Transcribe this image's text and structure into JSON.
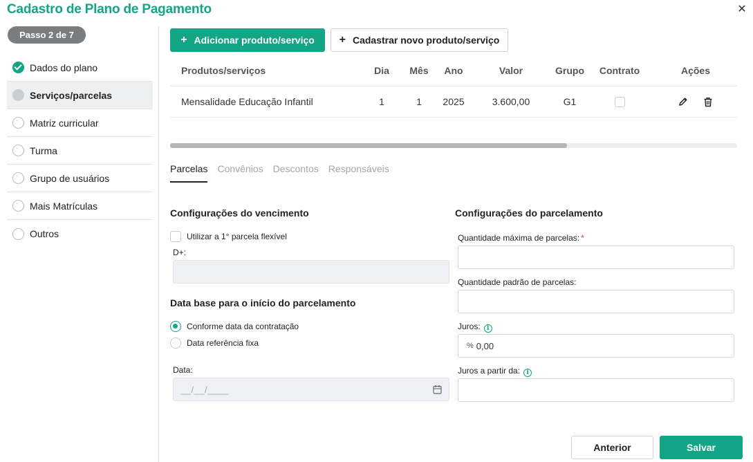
{
  "title": "Cadastro de Plano de Pagamento",
  "step_badge": "Passo 2 de 7",
  "sidebar": {
    "items": [
      {
        "label": "Dados do plano",
        "state": "done"
      },
      {
        "label": "Serviços/parcelas",
        "state": "current"
      },
      {
        "label": "Matriz curricular",
        "state": "pending"
      },
      {
        "label": "Turma",
        "state": "pending"
      },
      {
        "label": "Grupo de usuários",
        "state": "pending"
      },
      {
        "label": "Mais Matrículas",
        "state": "pending"
      },
      {
        "label": "Outros",
        "state": "pending"
      }
    ]
  },
  "toolbar": {
    "add_label": "Adicionar produto/serviço",
    "new_label": "Cadastrar novo produto/serviço"
  },
  "table": {
    "headers": {
      "produto": "Produtos/serviços",
      "dia": "Dia",
      "mes": "Mês",
      "ano": "Ano",
      "valor": "Valor",
      "grupo": "Grupo",
      "contrato": "Contrato",
      "acoes": "Ações"
    },
    "rows": [
      {
        "produto": "Mensalidade Educação Infantil",
        "dia": "1",
        "mes": "1",
        "ano": "2025",
        "valor": "3.600,00",
        "grupo": "G1",
        "contrato": false
      }
    ]
  },
  "scroll_position_fraction": 0.7,
  "tabs": [
    {
      "label": "Parcelas",
      "active": true
    },
    {
      "label": "Convênios",
      "active": false
    },
    {
      "label": "Descontos",
      "active": false
    },
    {
      "label": "Responsáveis",
      "active": false
    }
  ],
  "vencimento": {
    "title": "Configurações do vencimento",
    "flex_label": "Utilizar a 1° parcela flexível",
    "flex_checked": false,
    "dplus_label": "D+:",
    "dplus_value": ""
  },
  "data_base": {
    "title": "Data base para o início do parcelamento",
    "options": [
      {
        "label": "Conforme data da contratação",
        "selected": true
      },
      {
        "label": "Data referência fixa",
        "selected": false
      }
    ],
    "date_label": "Data:",
    "date_placeholder": "__/__/____"
  },
  "parcelamento": {
    "title": "Configurações do parcelamento",
    "max_label": "Quantidade máxima de parcelas:",
    "max_required": "*",
    "max_value": "",
    "default_label": "Quantidade padrão de parcelas:",
    "default_value": "",
    "juros_label": "Juros:",
    "juros_prefix": "%",
    "juros_value": "0,00",
    "juros_from_label": "Juros a partir da:",
    "juros_from_value": ""
  },
  "footer": {
    "prev_label": "Anterior",
    "save_label": "Salvar"
  },
  "colors": {
    "accent": "#12a586",
    "badge": "#7a7d80"
  }
}
